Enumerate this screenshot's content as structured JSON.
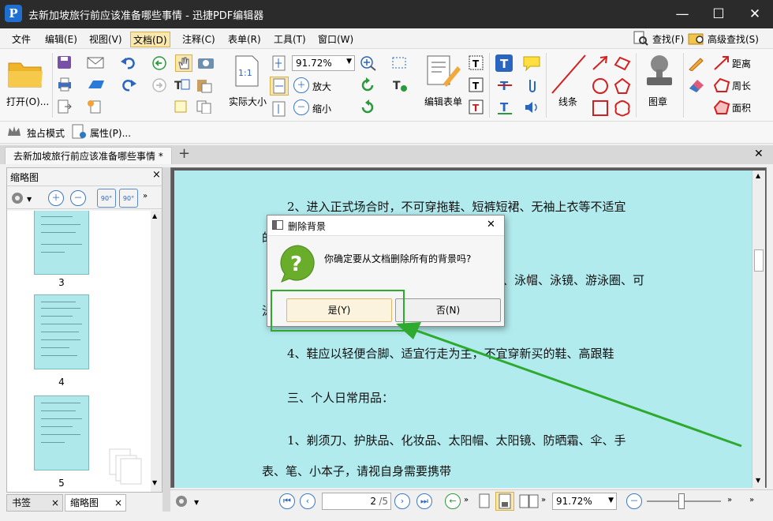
{
  "window": {
    "title": "去新加坡旅行前应该准备哪些事情 - 迅捷PDF编辑器",
    "logo_glyph": "P",
    "minimize": "—",
    "maximize": "☐",
    "close": "✕"
  },
  "menubar": {
    "items": [
      "文件",
      "编辑(E)",
      "视图(V)",
      "文档(D)",
      "注释(C)",
      "表单(R)",
      "工具(T)",
      "窗口(W)"
    ],
    "find": "查找(F)",
    "advanced_find": "高级查找(S)"
  },
  "ribbon": {
    "open_label": "打开(O)...",
    "zoom_value": "91.72%",
    "actual_size_label": "实际大小",
    "actual_size_glyph": "1:1",
    "zoom_in_label": "放大",
    "zoom_out_label": "缩小",
    "edit_form_label": "编辑表单",
    "line_label": "线条",
    "stamp_label": "图章",
    "distance_label": "距离",
    "perimeter_label": "周长",
    "area_label": "面积"
  },
  "subbar": {
    "exclusive_mode": "独占模式",
    "properties": "属性(P)..."
  },
  "document_tab": {
    "title": "去新加坡旅行前应该准备哪些事情 *",
    "add": "+",
    "close": "✕"
  },
  "left_panel": {
    "title": "缩略图",
    "close": "×",
    "rotate_left": "90°",
    "rotate_right": "90°",
    "page_numbers": [
      "3",
      "4",
      "5"
    ],
    "bottom_tabs": [
      "书签",
      "缩略图"
    ],
    "tab_close": "×"
  },
  "document": {
    "lines": [
      "2、进入正式场合时，不可穿拖鞋、短裤短裙、无袖上衣等不适宜",
      "的",
      "、泳帽、泳镜、游泳圈、可",
      "泳",
      "4、鞋应以轻便合脚、适宜行走为主，不宜穿新买的鞋、高跟鞋",
      "三、个人日常用品：",
      "1、剃须刀、护肤品、化妆品、太阳帽、太阳镜、防晒霜、伞、手",
      "表、笔、小本子，请视自身需要携带"
    ]
  },
  "statusbar": {
    "page_current": "2",
    "page_total": "/5",
    "zoom": "91.72%"
  },
  "dialog": {
    "title": "删除背景",
    "message": "你确定要从文档删除所有的背景吗?",
    "yes_button": "是(Y)",
    "no_button": "否(N)",
    "close": "✕",
    "icon_glyph": "?"
  },
  "colors": {
    "page_background": "#b2ebee",
    "highlight": "#2eaa2e",
    "titlebar": "#2b2b2b"
  }
}
